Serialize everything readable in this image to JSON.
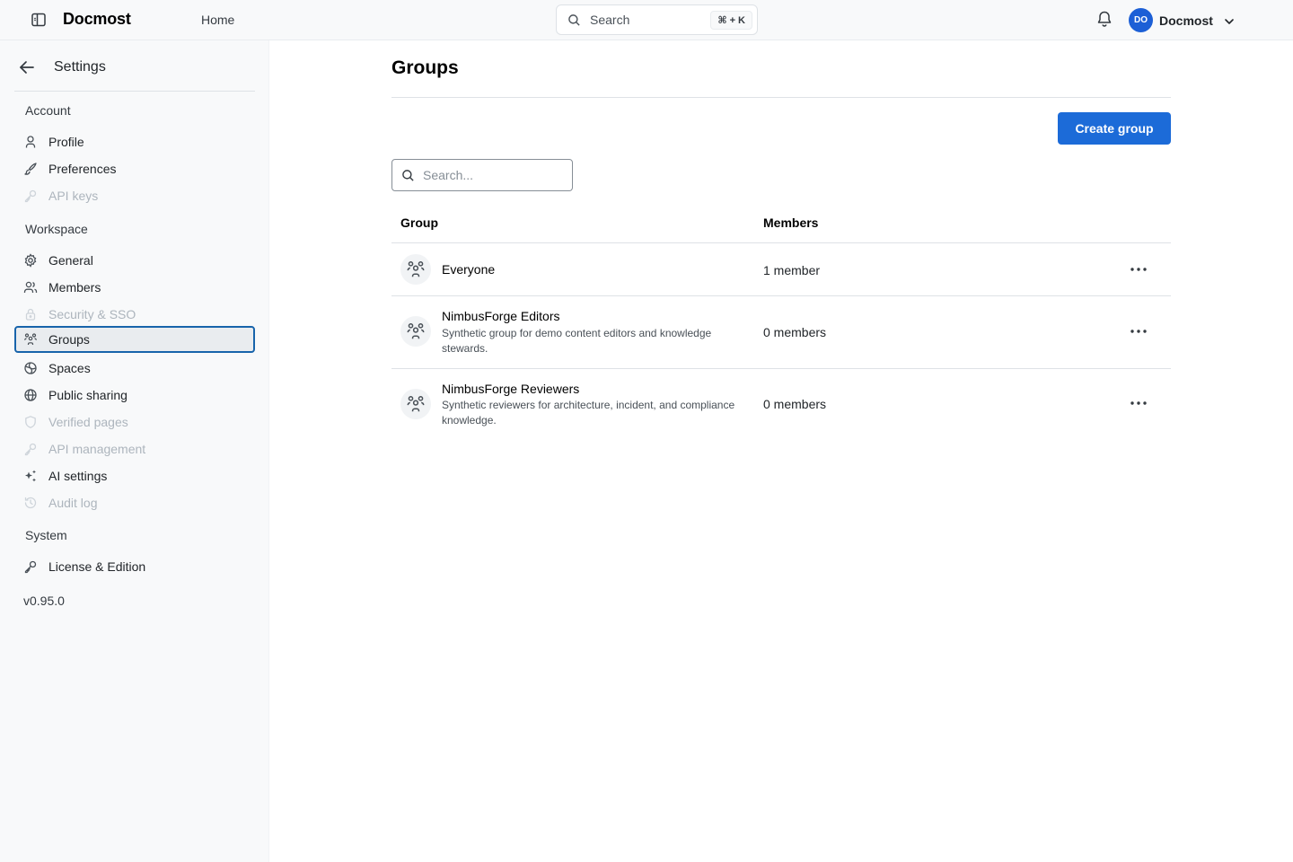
{
  "header": {
    "brand": "Docmost",
    "nav_home": "Home",
    "search": {
      "label": "Search",
      "shortcut": "⌘ + K"
    },
    "user": {
      "initials": "DO",
      "name": "Docmost"
    }
  },
  "sidebar": {
    "title": "Settings",
    "sections": [
      {
        "label": "Account"
      },
      {
        "label": "Workspace"
      },
      {
        "label": "System"
      }
    ],
    "items": [
      {
        "label": "Profile",
        "icon": "user-icon",
        "enabled": true
      },
      {
        "label": "Preferences",
        "icon": "brush-icon",
        "enabled": true
      },
      {
        "label": "API keys",
        "icon": "key-icon",
        "enabled": false
      },
      {
        "label": "General",
        "icon": "gear-icon",
        "enabled": true
      },
      {
        "label": "Members",
        "icon": "users-icon",
        "enabled": true
      },
      {
        "label": "Security & SSO",
        "icon": "lock-icon",
        "enabled": false
      },
      {
        "label": "Groups",
        "icon": "users-group-icon",
        "enabled": true,
        "active": true
      },
      {
        "label": "Spaces",
        "icon": "spaces-icon",
        "enabled": true
      },
      {
        "label": "Public sharing",
        "icon": "globe-icon",
        "enabled": true
      },
      {
        "label": "Verified pages",
        "icon": "shield-check-icon",
        "enabled": false
      },
      {
        "label": "API management",
        "icon": "key-icon",
        "enabled": false
      },
      {
        "label": "AI settings",
        "icon": "sparkles-icon",
        "enabled": true
      },
      {
        "label": "Audit log",
        "icon": "history-icon",
        "enabled": false
      },
      {
        "label": "License & Edition",
        "icon": "key-icon",
        "enabled": true
      }
    ],
    "version": "v0.95.0"
  },
  "main": {
    "title": "Groups",
    "create_label": "Create group",
    "filter_placeholder": "Search...",
    "columns": {
      "group": "Group",
      "members": "Members"
    },
    "groups": [
      {
        "name": "Everyone",
        "description": "",
        "members": "1 member"
      },
      {
        "name": "NimbusForge Editors",
        "description": "Synthetic group for demo content editors and knowledge stewards.",
        "members": "0 members"
      },
      {
        "name": "NimbusForge Reviewers",
        "description": "Synthetic reviewers for architecture, incident, and compliance knowledge.",
        "members": "0 members"
      }
    ]
  },
  "colors": {
    "accent": "#1c6bd8",
    "avatar": "#1c5fd6",
    "active_border": "#1864ab",
    "sidebar_bg": "#f8f9fa",
    "disabled_text": "#adb5bd"
  }
}
